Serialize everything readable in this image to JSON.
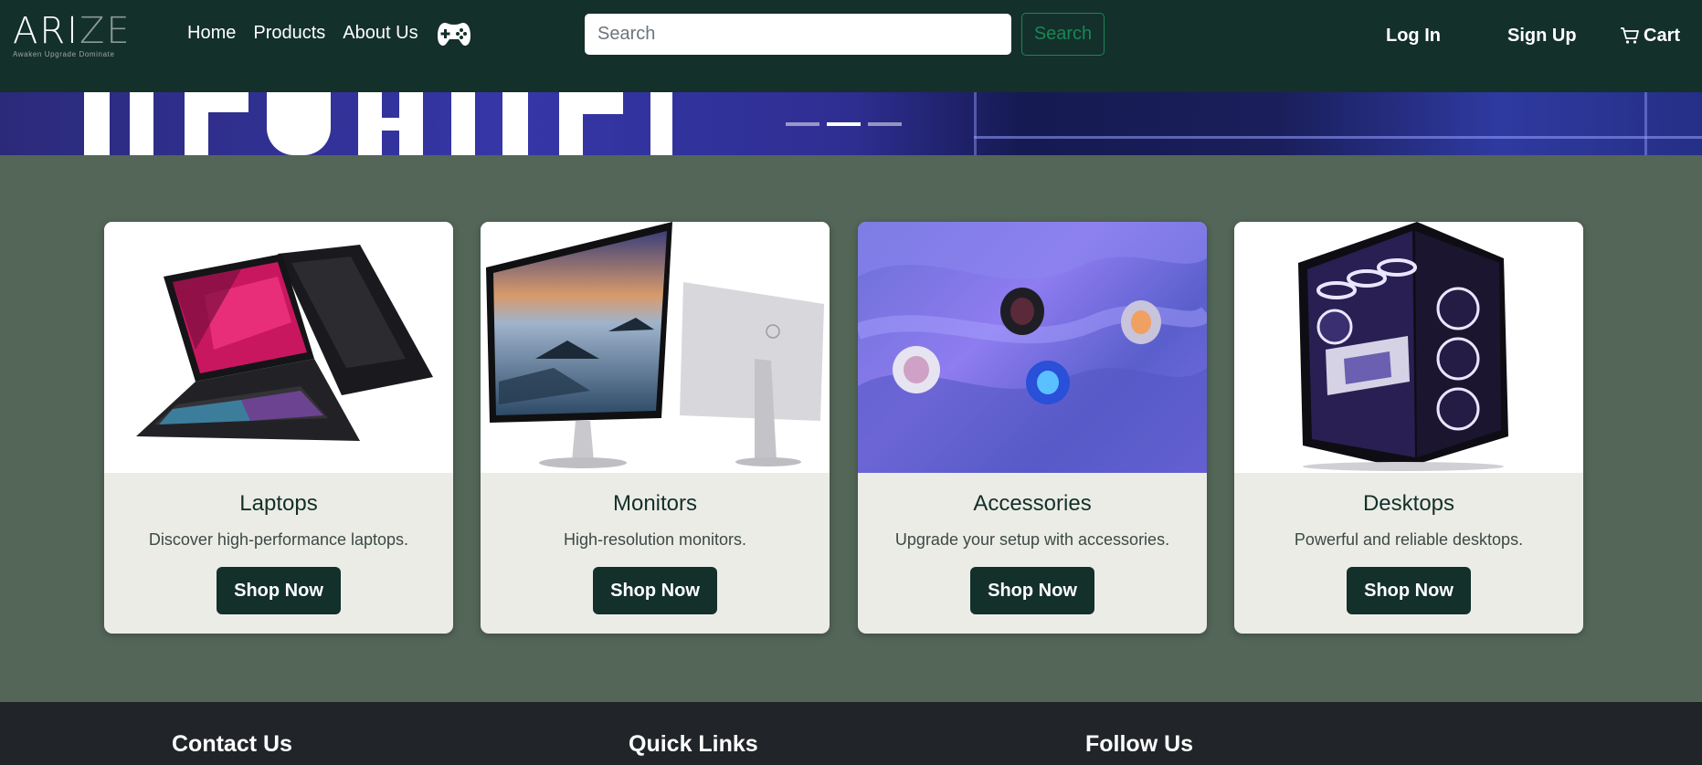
{
  "brand": {
    "logo_main": "ARI",
    "logo_dim": "ZE",
    "tagline": "Awaken Upgrade Dominate"
  },
  "nav": {
    "links": [
      "Home",
      "Products",
      "About Us"
    ],
    "gamepad_icon": "gamepad-icon"
  },
  "search": {
    "placeholder": "Search",
    "button_label": "Search"
  },
  "auth": {
    "login": "Log In",
    "signup": "Sign Up",
    "cart": "Cart",
    "cart_icon": "cart-icon"
  },
  "carousel": {
    "active_index": 1,
    "indicator_count": 3
  },
  "categories": [
    {
      "title": "Laptops",
      "description": "Discover high-performance laptops.",
      "button": "Shop Now"
    },
    {
      "title": "Monitors",
      "description": "High-resolution monitors.",
      "button": "Shop Now"
    },
    {
      "title": "Accessories",
      "description": "Upgrade your setup with accessories.",
      "button": "Shop Now"
    },
    {
      "title": "Desktops",
      "description": "Powerful and reliable desktops.",
      "button": "Shop Now"
    }
  ],
  "footer": {
    "headings": [
      "Contact Us",
      "Quick Links",
      "Follow Us"
    ]
  },
  "colors": {
    "nav_bg": "#13302b",
    "page_bg": "#536657",
    "card_bg": "#ecece6",
    "accent_green": "#198754",
    "footer_bg": "#212529"
  }
}
